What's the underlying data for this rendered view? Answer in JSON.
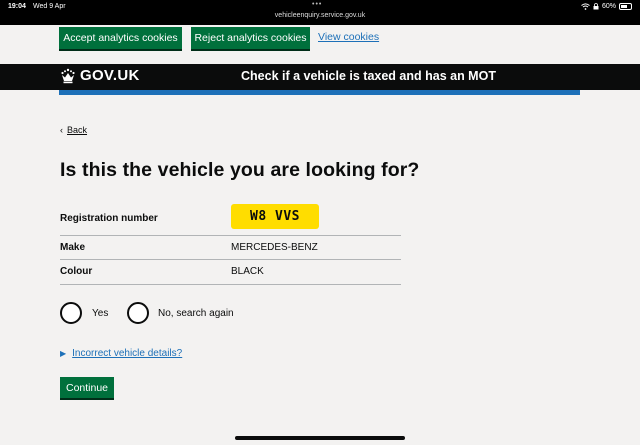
{
  "status_bar": {
    "time": "19:04",
    "date": "Wed 9 Apr",
    "url": "vehicleenquiry.service.gov.uk",
    "battery": "60%"
  },
  "cookie_banner": {
    "accept_label": "Accept analytics cookies",
    "reject_label": "Reject analytics cookies",
    "view_label": "View cookies"
  },
  "header": {
    "logo_text": "GOV.UK",
    "service_name": "Check if a vehicle is taxed and has an MOT"
  },
  "main": {
    "back_label": "Back",
    "title": "Is this the vehicle you are looking for?",
    "summary": {
      "registration_key": "Registration number",
      "registration_value": "W8 VVS",
      "make_key": "Make",
      "make_value": "MERCEDES-BENZ",
      "colour_key": "Colour",
      "colour_value": "BLACK"
    },
    "radios": {
      "yes_label": "Yes",
      "no_label": "No, search again"
    },
    "details_label": "Incorrect vehicle details?",
    "continue_label": "Continue"
  },
  "colors": {
    "button_green": "#00703c",
    "link_blue": "#1d70b8",
    "header_black": "#0b0c0c",
    "plate_yellow": "#ffdd00"
  },
  "icons": {
    "crown": "crown-icon",
    "back": "chevron-left-icon",
    "details": "triangle-right-icon",
    "wifi": "wifi-icon",
    "battery": "battery-icon"
  }
}
